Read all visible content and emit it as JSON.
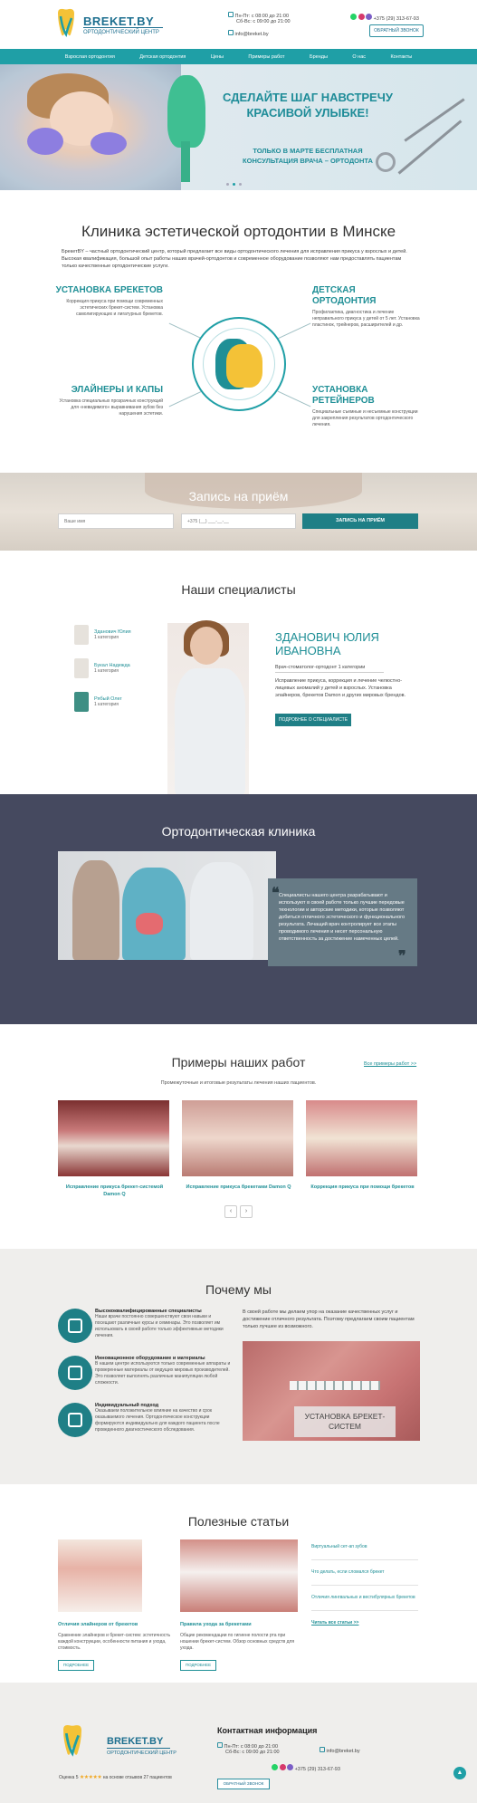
{
  "header": {
    "logo_name": "BREKET.BY",
    "logo_sub": "ОРТОДОНТИЧЕСКИЙ ЦЕНТР",
    "hours1": "Пн-Пт: с 08:00 до 21:00",
    "hours2": "Сб-Вс: с 09:00 до 21:00",
    "email": "info@breket.by",
    "phone": "+375 (29) 313-67-93",
    "call_btn": "ОБРАТНЫЙ ЗВОНОК"
  },
  "nav": [
    "Взрослая ортодонтия",
    "Детская ортодонтия",
    "Цены",
    "Примеры работ",
    "Бренды",
    "О нас",
    "Контакты"
  ],
  "hero": {
    "title": "СДЕЛАЙТЕ ШАГ НАВСТРЕЧУ КРАСИВОЙ УЛЫБКЕ!",
    "subtitle": "ТОЛЬКО В МАРТЕ БЕСПЛАТНАЯ КОНСУЛЬТАЦИЯ ВРАЧА – ОРТОДОНТА"
  },
  "clinic": {
    "title": "Клиника эстетической ортодонтии в Минске",
    "text": "БрекетBY – частный ортодонтический центр, который предлагает все виды ортодонтического лечения для исправления прикуса у взрослых и детей. Высокая квалификация, большой опыт работы наших врачей-ортодонтов и современное оборудование позволяют нам предоставлять пациентам только качественные ортодонтические услуги.",
    "services": [
      {
        "title": "УСТАНОВКА БРЕКЕТОВ",
        "text": "Коррекция прикуса при помощи современных эстетических брекет-систем. Установка самолигирующих и лигатурных брекетов."
      },
      {
        "title": "ЭЛАЙНЕРЫ И КАПЫ",
        "text": "Установка специальных прозрачных конструкций для «невидимого» выравнивания зубов без нарушения эстетики."
      },
      {
        "title": "ДЕТСКАЯ ОРТОДОНТИЯ",
        "text": "Профилактика, диагностика и лечение неправильного прикуса у детей от 5 лет. Установка пластинок, трейнеров, расширителей и др."
      },
      {
        "title": "УСТАНОВКА РЕТЕЙНЕРОВ",
        "text": "Специальные съемные и несъемные конструкции для закрепления результатов ортодонтического лечения."
      }
    ]
  },
  "appointment": {
    "title": "Запись на приём",
    "name_ph": "Ваше имя",
    "phone_ph": "+375 (__) ___-__-__",
    "button": "ЗАПИСЬ НА ПРИЁМ"
  },
  "specialists": {
    "title": "Наши специалисты",
    "list": [
      {
        "name": "Зданович Юлия",
        "cat": "1 категория"
      },
      {
        "name": "Букал Надежда",
        "cat": "1 категория"
      },
      {
        "name": "Рябый Олег",
        "cat": "1 категория"
      }
    ],
    "featured": {
      "name": "ЗДАНОВИЧ ЮЛИЯ ИВАНОВНА",
      "role": "Врач-стоматолог-ортодонт 1 категории",
      "desc": "Исправление прикуса, коррекция и лечение челюстно-лицевых аномалий у детей и взрослых. Установка элайнеров, брекетов Damon и других мировых брендов.",
      "button": "ПОДРОБНЕЕ О СПЕЦИАЛИСТЕ"
    }
  },
  "ortho": {
    "title": "Ортодонтическая клиника",
    "quote": "Специалисты нашего центра разрабатывают и используют в своей работе только лучшие передовые технологии и авторские методики, которые позволяют добиться отличного эстетического и функционального результата. Лечащий врач контролирует все этапы проводимого лечения и несет персональную ответственность за достижение намеченных целей."
  },
  "works": {
    "title": "Примеры наших работ",
    "all_link": "Все примеры работ >>",
    "subtitle": "Промежуточные и итоговые результаты лечения наших пациентов.",
    "items": [
      "Исправление прикуса брекет-системой Damon Q",
      "Исправление прикуса брекетами Damon Q",
      "Коррекция прикуса при помощи брекетов"
    ],
    "prev": "‹",
    "next": "›"
  },
  "why": {
    "title": "Почему мы",
    "intro": "В своей работе мы делаем упор на оказание качественных услуг и достижение отличного результата. Поэтому предлагаем своим пациентам только лучшее из возможного.",
    "items": [
      {
        "title": "Высококвалифицированные специалисты",
        "text": "Наши врачи постоянно совершенствуют свои навыки и посещают различные курсы и семинары. Это позволяет им использовать в своей работе только эффективные методики лечения."
      },
      {
        "title": "Инновационное оборудование и материалы",
        "text": "В нашем центре используются только современные аппараты и проверенные материалы от ведущих мировых производителей. Это позволяет выполнять различные манипуляции любой сложности."
      },
      {
        "title": "Индивидуальный подход",
        "text": "Оказываем положительное влияние на качество и срок оказываемого лечения. Ортодонтическое конструкции формируются индивидуально для каждого пациента после проведенного диагностического обследования."
      }
    ],
    "image_label": "УСТАНОВКА БРЕКЕТ-СИСТЕМ"
  },
  "articles": {
    "title": "Полезные статьи",
    "cards": [
      {
        "title": "Отличия элайнеров от брекетов",
        "text": "Сравнение элайнеров и брекет-систем: эстетичность каждой конструкции, особенности питания и ухода, стоимость.",
        "button": "ПОДРОБНЕЕ"
      },
      {
        "title": "Правила ухода за брекетами",
        "text": "Общие рекомендации по гигиене полости рта при ношении брекет-систем. Обзор основных средств для ухода.",
        "button": "ПОДРОБНЕЕ"
      }
    ],
    "links": [
      "Виртуальный сет-ап зубов",
      "Что делать, если сломался брекет",
      "Отличия лингвальных и вестибулярных брекетов"
    ],
    "all_link": "Читать все статьи >>"
  },
  "footer": {
    "logo_name": "BREKET.BY",
    "logo_sub": "ОРТОДОНТИЧЕСКИЙ ЦЕНТР",
    "rating_prefix": "Оценка 5",
    "stars": "★★★★★",
    "rating_suffix": "на основе отзывов 27 пациентов",
    "contact_title": "Контактная информация",
    "hours1": "Пн-Пт: с 08:00 до 21:00",
    "hours2": "Сб-Вс: с 09:00 до 21:00",
    "email": "info@breket.by",
    "phone": "+375 (29) 313-67-93",
    "call_btn": "ОБРАТНЫЙ ЗВОНОК",
    "up": "▲"
  },
  "colors": {
    "primary": "#1f9fa6",
    "dark": "#45495f",
    "accent": "#f4c237"
  }
}
